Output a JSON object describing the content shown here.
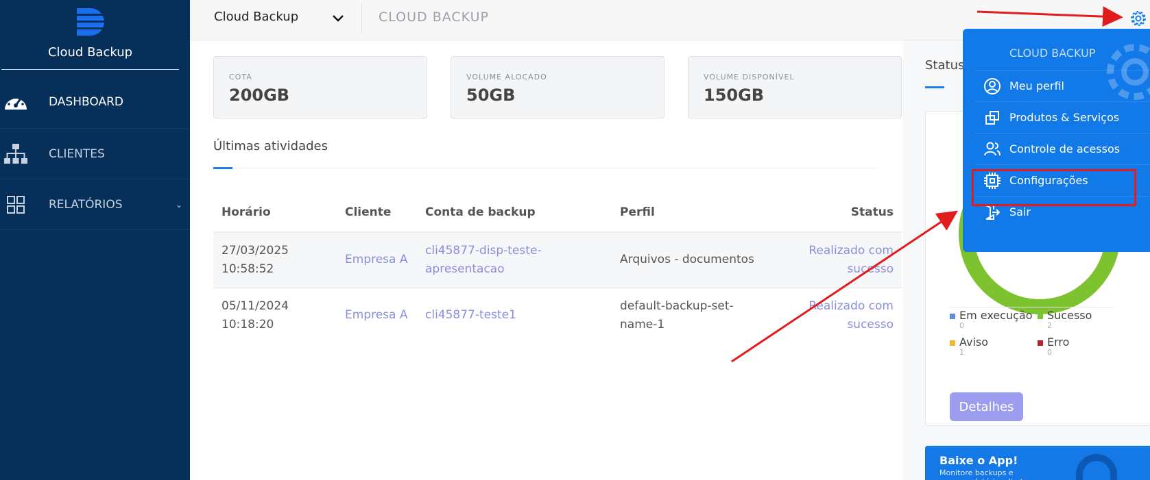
{
  "sidebar": {
    "brand": "Cloud Backup",
    "items": [
      {
        "label": "DASHBOARD",
        "icon": "gauge-icon"
      },
      {
        "label": "CLIENTES",
        "icon": "org-chart-icon"
      },
      {
        "label": "RELATÓRIOS",
        "icon": "grid-icon"
      }
    ]
  },
  "header": {
    "selector": "Cloud Backup",
    "title": "CLOUD BACKUP"
  },
  "cards": [
    {
      "label": "COTA",
      "value": "200GB"
    },
    {
      "label": "VOLUME ALOCADO",
      "value": "50GB"
    },
    {
      "label": "VOLUME DISPONÍVEL",
      "value": "150GB"
    }
  ],
  "activities": {
    "title": "Últimas atividades",
    "columns": [
      "Horário",
      "Cliente",
      "Conta de backup",
      "Perfil",
      "Status"
    ],
    "rows": [
      {
        "time": "27/03/2025 10:58:52",
        "client": "Empresa A",
        "account": "cli45877-disp-teste-apresentacao",
        "profile": "Arquivos - documentos",
        "status": "Realizado com sucesso"
      },
      {
        "time": "05/11/2024 10:18:20",
        "client": "Empresa A",
        "account": "cli45877-teste1",
        "profile": "default-backup-set-name-1",
        "status": "Realizado com sucesso"
      }
    ]
  },
  "status_panel": {
    "title": "Status",
    "legend": [
      {
        "label": "Em execução",
        "count": "0",
        "color": "#5b8fdc"
      },
      {
        "label": "Sucesso",
        "count": "2",
        "color": "#7dc22f"
      },
      {
        "label": "Aviso",
        "count": "1",
        "color": "#f0b72f"
      },
      {
        "label": "Erro",
        "count": "0",
        "color": "#b8202a"
      }
    ],
    "details_button": "Detalhes",
    "banner_title": "Baixe o App!",
    "banner_sub": "Monitore backups e acesse relatórios direto do seu"
  },
  "dropdown": {
    "title": "CLOUD BACKUP",
    "items": [
      {
        "label": "Meu perfil",
        "icon": "user-circle-icon"
      },
      {
        "label": "Produtos & Serviços",
        "icon": "copy-icon"
      },
      {
        "label": "Controle de acessos",
        "icon": "users-icon"
      },
      {
        "label": "Configurações",
        "icon": "chip-icon"
      },
      {
        "label": "Sair",
        "icon": "logout-icon"
      }
    ]
  },
  "colors": {
    "sidebar": "#06305a",
    "accent": "#1279e8",
    "link": "#8a8fdc",
    "highlight": "#e11c1c"
  }
}
